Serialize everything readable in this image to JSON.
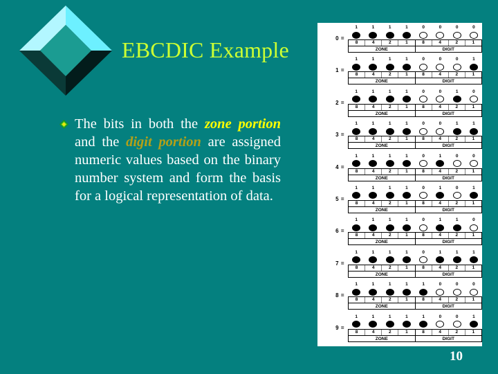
{
  "slide": {
    "background_color": "#04807f",
    "title": "EBCDIC Example",
    "title_color": "#ccff33",
    "page_number": "10"
  },
  "logo": {
    "name": "diamond-bevel-logo",
    "face_color": "#1a9b92",
    "highlight_color": "#7ff5ff",
    "shadow_color": "#062f2d"
  },
  "bullet": {
    "marker": "diamond-bullet",
    "marker_color": "#33cc33",
    "text_color": "#ffffff",
    "segments": [
      {
        "text": "The  bits  in  both  the  ",
        "style": "plain"
      },
      {
        "text": "zone portion",
        "style": "zone"
      },
      {
        "text": " and the ",
        "style": "plain"
      },
      {
        "text": "digit portion",
        "style": "digit"
      },
      {
        "text": " are  assigned  numeric  values  based  on  the  binary  number  system and form the basis for a  logical  representation  of  data.",
        "style": "plain"
      }
    ],
    "full_text": "The bits in both the zone portion and the digit portion are assigned numeric values based on the binary number system and form the basis for a logical representation of data.",
    "emphasis_zone_color": "#ffff00",
    "emphasis_digit_color": "#b3a018"
  },
  "figure": {
    "name": "ebcdic-digit-encoding-chart",
    "panel_background": "#ffffff",
    "group_labels": {
      "zone": "ZONE",
      "digit": "DIGIT"
    },
    "place_values": [
      "8",
      "4",
      "2",
      "1",
      "8",
      "4",
      "2",
      "1"
    ],
    "label_suffix": " =",
    "rows": [
      {
        "char": "0",
        "bits": [
          1,
          1,
          1,
          1,
          0,
          0,
          0,
          0
        ]
      },
      {
        "char": "1",
        "bits": [
          1,
          1,
          1,
          1,
          0,
          0,
          0,
          1
        ]
      },
      {
        "char": "2",
        "bits": [
          1,
          1,
          1,
          1,
          0,
          0,
          1,
          0
        ]
      },
      {
        "char": "3",
        "bits": [
          1,
          1,
          1,
          1,
          0,
          0,
          1,
          1
        ]
      },
      {
        "char": "4",
        "bits": [
          1,
          1,
          1,
          1,
          0,
          1,
          0,
          0
        ]
      },
      {
        "char": "5",
        "bits": [
          1,
          1,
          1,
          1,
          0,
          1,
          0,
          1
        ]
      },
      {
        "char": "6",
        "bits": [
          1,
          1,
          1,
          1,
          0,
          1,
          1,
          0
        ]
      },
      {
        "char": "7",
        "bits": [
          1,
          1,
          1,
          1,
          0,
          1,
          1,
          1
        ]
      },
      {
        "char": "8",
        "bits": [
          1,
          1,
          1,
          1,
          1,
          0,
          0,
          0
        ]
      },
      {
        "char": "9",
        "bits": [
          1,
          1,
          1,
          1,
          1,
          0,
          0,
          1
        ]
      }
    ]
  }
}
